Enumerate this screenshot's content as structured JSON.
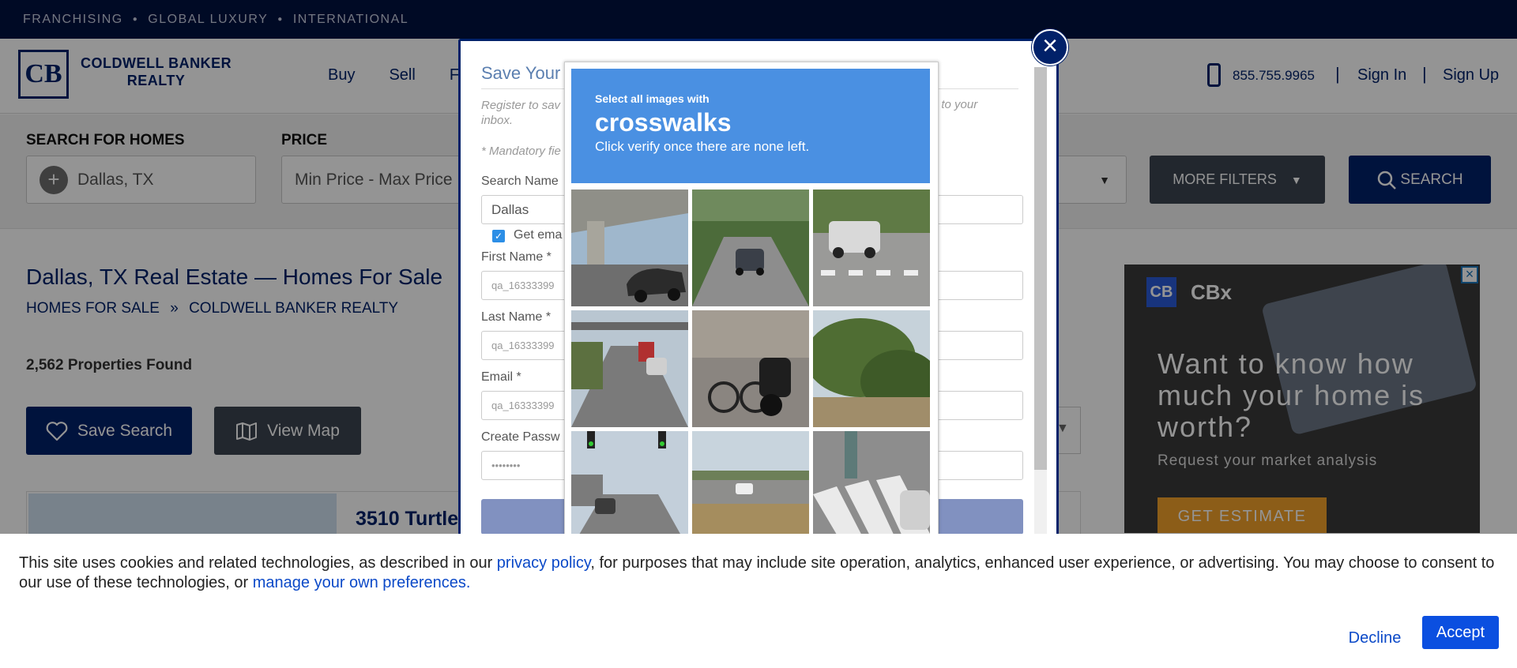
{
  "topbar": {
    "items": [
      "FRANCHISING",
      "GLOBAL LUXURY",
      "INTERNATIONAL"
    ]
  },
  "header": {
    "logo_mark": "CB",
    "logo_line1": "COLDWELL BANKER",
    "logo_line2": "REALTY",
    "nav": [
      "Buy",
      "Sell",
      "F"
    ],
    "phone": "855.755.9965",
    "sign_in": "Sign In",
    "sign_up": "Sign Up"
  },
  "search": {
    "location_label": "SEARCH FOR HOMES",
    "location_value": "Dallas, TX",
    "price_label": "PRICE",
    "price_value": "Min Price  -  Max Price",
    "more_filters": "MORE FILTERS",
    "search_button": "SEARCH"
  },
  "content": {
    "title": "Dallas, TX Real Estate — Homes For Sale",
    "breadcrumb_1": "HOMES FOR SALE",
    "breadcrumb_sep": "»",
    "breadcrumb_2": "COLDWELL BANKER REALTY",
    "count": "2,562 Properties Found",
    "save_search": "Save Search",
    "view_map": "View Map",
    "listing_address": "3510 Turtle"
  },
  "ad": {
    "brand": "CBx",
    "headline": "Want to know how much your home is worth?",
    "sub": "Request your market analysis",
    "cta": "GET ESTIMATE"
  },
  "modal": {
    "title": "Save Your",
    "note_left": "Register to sav",
    "note_left2": "inbox.",
    "note_right": "t to your",
    "mandatory": "* Mandatory fie",
    "search_name_label": "Search Name",
    "search_name_value": "Dallas",
    "get_email_label": "Get ema",
    "first_name_label": "First Name *",
    "first_name_value": "qa_16333399",
    "last_name_label": "Last Name *",
    "last_name_value": "qa_16333399",
    "email_label": "Email *",
    "email_value": "qa_16333399",
    "password_label": "Create Passw",
    "password_value": "••••••••"
  },
  "captcha": {
    "instruction_small": "Select all images with",
    "target": "crosswalks",
    "instruction_sub": "Click verify once there are none left."
  },
  "cookie": {
    "text_before": "This site uses cookies and related technologies, as described in our ",
    "privacy_link": "privacy policy",
    "text_middle": ", for purposes that may include site operation, analytics, enhanced user experience, or advertising. You may choose to consent to our use of these technologies, or ",
    "prefs_link": "manage your own preferences",
    "text_after": ".",
    "decline": "Decline",
    "accept": "Accept"
  }
}
